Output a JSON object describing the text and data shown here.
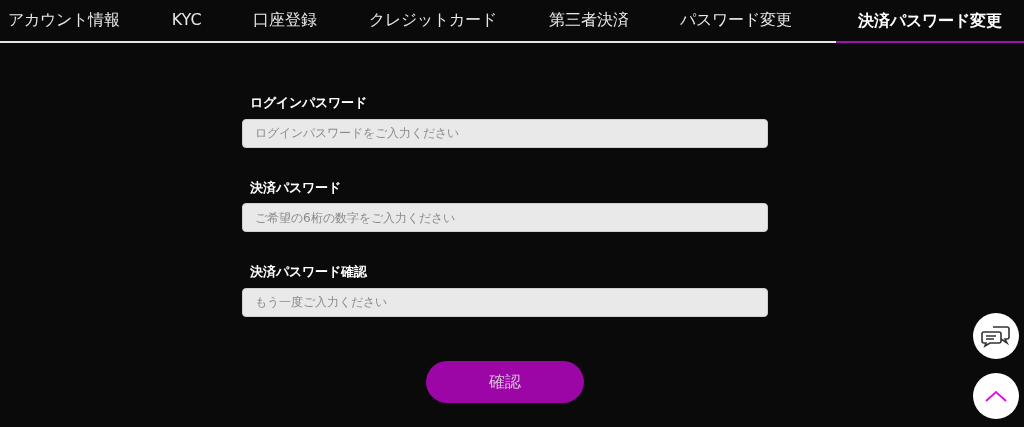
{
  "tabs": [
    {
      "label": "アカウント情報",
      "selected": false
    },
    {
      "label": "KYC",
      "selected": false
    },
    {
      "label": "口座登録",
      "selected": false
    },
    {
      "label": "クレジットカード",
      "selected": false
    },
    {
      "label": "第三者決済",
      "selected": false
    },
    {
      "label": "パスワード変更",
      "selected": false
    },
    {
      "label": "決済パスワード変更",
      "selected": true
    }
  ],
  "form": {
    "fields": [
      {
        "label": "ログインパスワード",
        "placeholder": "ログインパスワードをご入力ください"
      },
      {
        "label": "決済パスワード",
        "placeholder": "ご希望の6桁の数字をご入力ください"
      },
      {
        "label": "決済パスワード確認",
        "placeholder": "もう一度ご入力ください"
      }
    ],
    "submit": "確認"
  }
}
